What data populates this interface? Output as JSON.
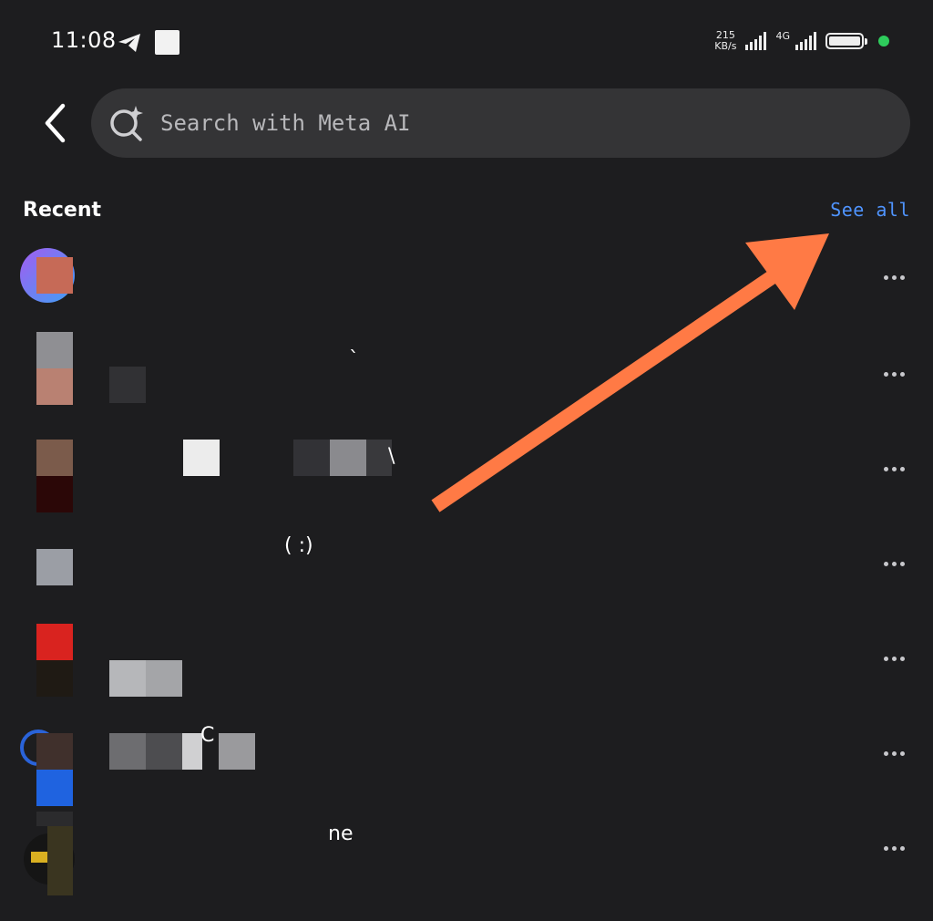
{
  "status_bar": {
    "time": "11:08",
    "speed_value": "215",
    "speed_unit": "KB/s",
    "network": "4G",
    "battery_percent": 100
  },
  "search": {
    "placeholder": "Search with Meta AI",
    "icon": "meta-ai-search-icon"
  },
  "recent": {
    "title": "Recent",
    "see_all_label": "See all",
    "link_color": "#4f94ff",
    "rows": [
      {
        "text": ""
      },
      {
        "text": "`"
      },
      {
        "text": "\\"
      },
      {
        "text": "( :)"
      },
      {
        "text": ""
      },
      {
        "text": "C"
      },
      {
        "text": "ne"
      }
    ]
  },
  "annotation": {
    "arrow_color": "#ff7a45"
  }
}
